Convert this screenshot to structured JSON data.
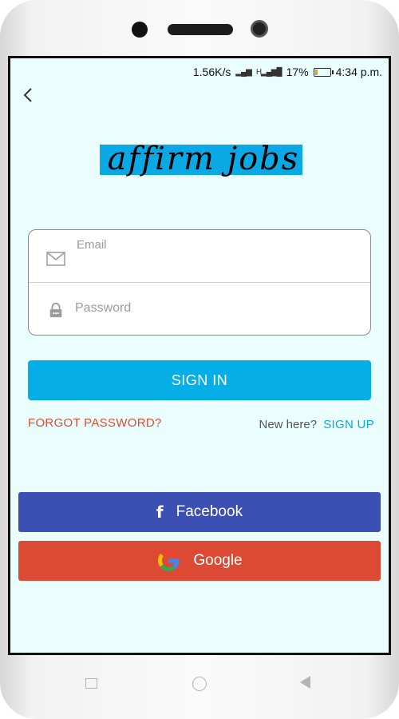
{
  "status_bar": {
    "speed": "1.56K/s",
    "battery_percent": "17%",
    "time": "4:34 p.m."
  },
  "header": {
    "back_icon": "chevron-left-icon"
  },
  "logo": {
    "text": "affirm jobs",
    "highlight_color": "#0aa9e6"
  },
  "form": {
    "email_label": "Email",
    "email_value": "",
    "password_placeholder": "Password",
    "password_value": "",
    "email_icon": "mail-icon",
    "password_icon": "lock-icon"
  },
  "actions": {
    "signin_label": "SIGN IN",
    "forgot_label": "FORGOT PASSWORD?",
    "new_here_label": "New here?",
    "signup_label": "SIGN UP"
  },
  "social": {
    "facebook_label": "Facebook",
    "google_label": "Google",
    "facebook_color": "#3c50b4",
    "google_color": "#dc4a34"
  },
  "colors": {
    "accent": "#06aee8",
    "link_red": "#dd4b32",
    "background": "#eafefe"
  }
}
